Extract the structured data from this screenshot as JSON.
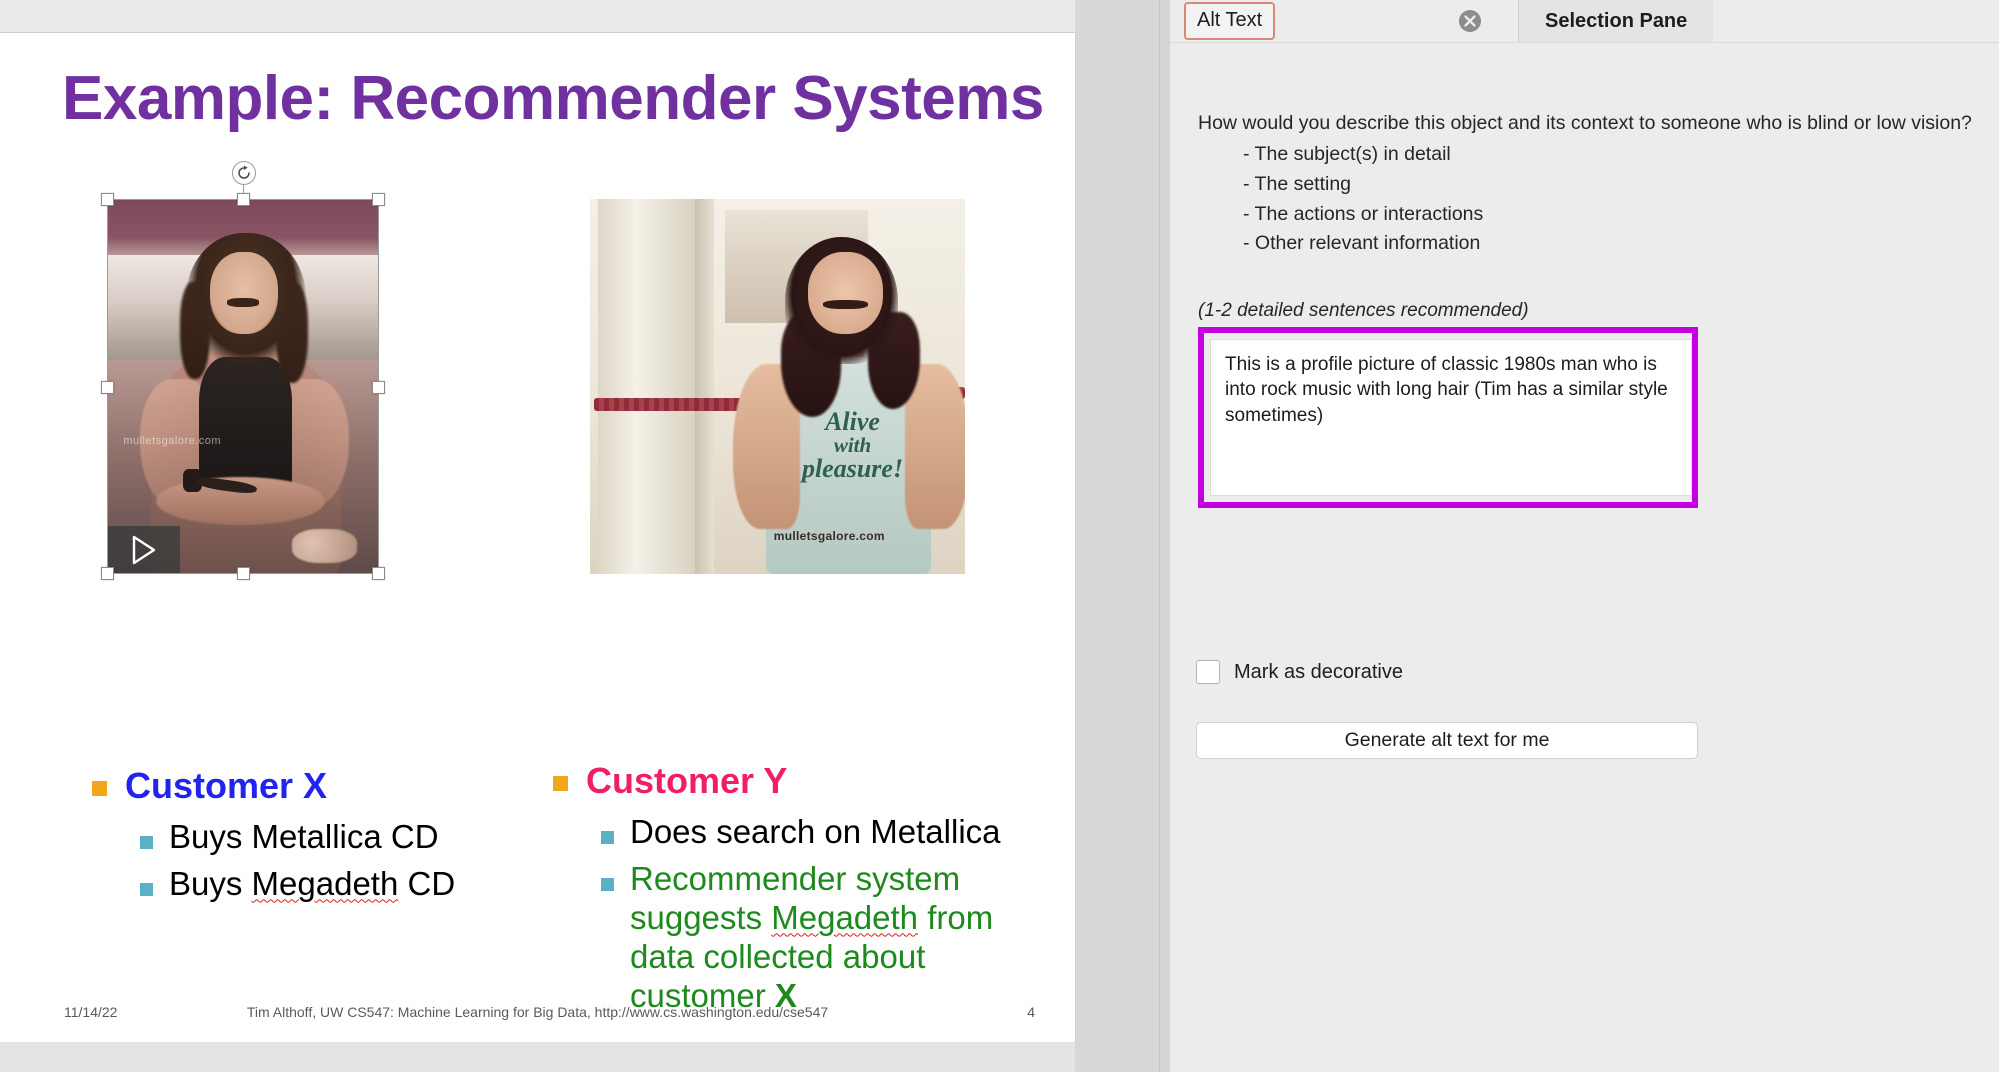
{
  "slide": {
    "title": "Example: Recommender Systems",
    "title_color": "#7030A0",
    "left_image": {
      "watermark": "mulletsgalore.com",
      "play_icon": "play-triangle-icon",
      "rotate_icon": "rotate-handle-icon"
    },
    "right_image": {
      "shirt_line1": "Alive",
      "shirt_line2": "with",
      "shirt_line3": "pleasure!",
      "watermark": "mulletsgalore.com"
    },
    "columns": {
      "left": {
        "heading": "Customer X",
        "heading_color": "#2323F0",
        "bullets": [
          {
            "prefix": "Buys Metallica CD",
            "misspelled": "",
            "suffix": ""
          },
          {
            "prefix": "Buys ",
            "misspelled": "Megadeth",
            "suffix": " CD"
          }
        ]
      },
      "right": {
        "heading": "Customer Y",
        "heading_color": "#F01E64",
        "bullets": [
          {
            "text": "Does search on Metallica",
            "color": "#000000"
          },
          {
            "text": "Recommender system suggests Megadeth from data collected about customer X",
            "color": "#1E8A1E"
          }
        ],
        "bullet2_parts": {
          "a": "Recommender system suggests ",
          "misspelled": "Megadeth",
          "b": " from data collected about customer ",
          "bold": "X"
        }
      }
    },
    "footer": {
      "date": "11/14/22",
      "text": "Tim Althoff, UW CS547: Machine Learning for Big Data, http://www.cs.washington.edu/cse547",
      "page": "4"
    }
  },
  "task_pane": {
    "tabs": {
      "alt_text": "Alt Text",
      "selection_pane": "Selection Pane",
      "close_icon": "close-circle-icon"
    },
    "prompt": {
      "question": "How would you describe this object and its context to someone who is blind or low vision?",
      "items": [
        "- The subject(s) in detail",
        "- The setting",
        "- The actions or interactions",
        "- Other relevant information"
      ],
      "hint": "(1-2 detailed sentences recommended)"
    },
    "alt_text_value": "This is a profile picture of classic 1980s man who is into rock music with long hair (Tim has a similar style sometimes)",
    "alt_text_highlight_color": "#C400E0",
    "decorative_checkbox_label": "Mark as decorative",
    "decorative_checked": false,
    "generate_button_label": "Generate alt text for me"
  }
}
